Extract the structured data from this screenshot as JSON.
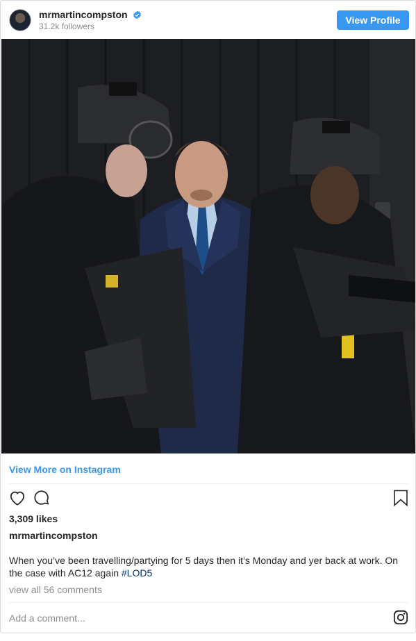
{
  "header": {
    "username": "mrmartincompston",
    "followers": "31.2k followers",
    "view_profile_label": "View Profile",
    "verified_icon": "verified-badge-icon"
  },
  "post": {
    "image_icon": "photo",
    "view_more_label": "View More on Instagram",
    "likes": "3,309 likes",
    "caption_user": "mrmartincompston",
    "caption_text": "When you’ve been travelling/partying for 5 days then it’s Monday and yer back at work. On the case with AC12 again ",
    "hashtag": "#LOD5",
    "comments_link": "view all 56 comments",
    "add_comment_placeholder": "Add a comment..."
  },
  "actions": {
    "like_icon": "heart-icon",
    "comment_icon": "comment-icon",
    "save_icon": "bookmark-icon"
  },
  "footer": {
    "brand_icon": "instagram-icon"
  },
  "colors": {
    "accent": "#3897f0",
    "hashtag": "#003569",
    "muted": "#8e8e8e",
    "text": "#262626",
    "border": "#dbdbdb"
  }
}
